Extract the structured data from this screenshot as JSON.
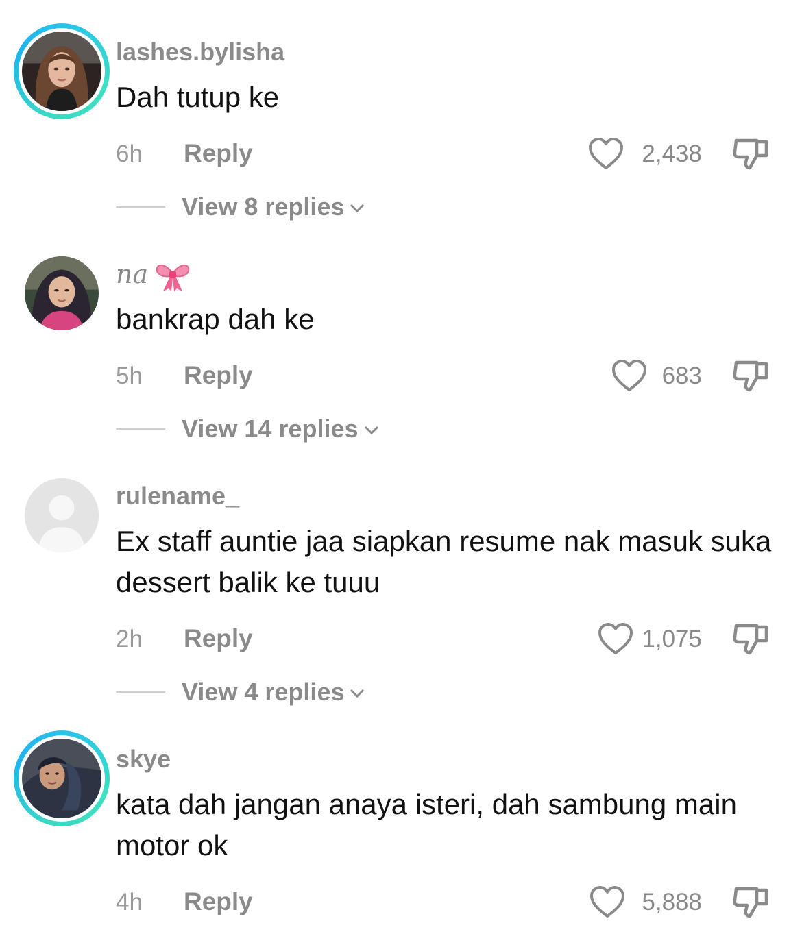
{
  "comments": [
    {
      "username": "lashes.bylisha",
      "text": "Dah tutup ke",
      "time": "6h",
      "reply": "Reply",
      "likes": "2,438",
      "view_replies": "View 8 replies"
    },
    {
      "username": "na",
      "text": "bankrap dah ke",
      "time": "5h",
      "reply": "Reply",
      "likes": "683",
      "view_replies": "View 14 replies"
    },
    {
      "username": "rulename_",
      "text": "Ex staff auntie jaa siapkan resume nak masuk suka dessert balik ke tuuu",
      "time": "2h",
      "reply": "Reply",
      "likes": "1,075",
      "view_replies": "View 4 replies"
    },
    {
      "username": "skye",
      "text": "kata dah jangan anaya isteri, dah sambung main motor ok",
      "time": "4h",
      "reply": "Reply",
      "likes": "5,888"
    }
  ],
  "icons": {
    "like": "heart-outline-icon",
    "dislike": "thumbs-down-outline-icon",
    "expand": "chevron-down-icon",
    "emoji": "pink-ribbon-bow-emoji"
  },
  "colors": {
    "story_ring_start": "#3bd7c5",
    "story_ring_end": "#20b4f0",
    "muted_text": "#8a8a8a"
  }
}
